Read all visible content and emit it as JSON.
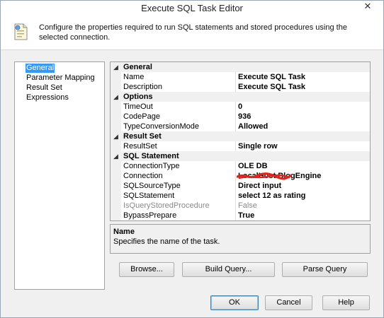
{
  "window": {
    "title": "Execute SQL Task Editor",
    "close_label": "✕"
  },
  "header": {
    "description": "Configure the properties required to run SQL statements and stored procedures using the selected connection."
  },
  "nav": {
    "items": [
      {
        "label": "General",
        "selected": true
      },
      {
        "label": "Parameter Mapping",
        "selected": false
      },
      {
        "label": "Result Set",
        "selected": false
      },
      {
        "label": "Expressions",
        "selected": false
      }
    ]
  },
  "grid": {
    "categories": [
      {
        "label": "General",
        "toggle": "◢"
      },
      {
        "label": "Options",
        "toggle": "◢"
      },
      {
        "label": "Result Set",
        "toggle": "◢"
      },
      {
        "label": "SQL Statement",
        "toggle": "◢"
      }
    ],
    "properties": [
      {
        "name": "Name",
        "value": "Execute SQL Task"
      },
      {
        "name": "Description",
        "value": "Execute SQL Task"
      },
      {
        "name": "TimeOut",
        "value": "0"
      },
      {
        "name": "CodePage",
        "value": "936"
      },
      {
        "name": "TypeConversionMode",
        "value": "Allowed"
      },
      {
        "name": "ResultSet",
        "value": "Single row"
      },
      {
        "name": "ConnectionType",
        "value": "OLE DB"
      },
      {
        "name": "Connection",
        "value": "LocalHost.BlogEngine"
      },
      {
        "name": "SQLSourceType",
        "value": "Direct input"
      },
      {
        "name": "SQLStatement",
        "value": "select 12 as rating"
      },
      {
        "name": "IsQueryStoredProcedure",
        "value": "False"
      },
      {
        "name": "BypassPrepare",
        "value": "True"
      }
    ]
  },
  "description_panel": {
    "title": "Name",
    "text": "Specifies the name of the task."
  },
  "buttons": {
    "browse": "Browse...",
    "build_query": "Build Query...",
    "parse_query": "Parse Query",
    "ok": "OK",
    "cancel": "Cancel",
    "help": "Help"
  },
  "colors": {
    "selection": "#3399ff",
    "redaction": "#e8201a"
  }
}
